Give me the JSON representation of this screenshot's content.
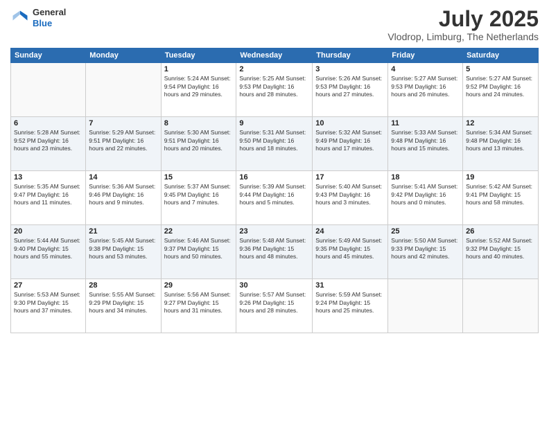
{
  "header": {
    "logo": {
      "line1": "General",
      "line2": "Blue"
    },
    "title": "July 2025",
    "location": "Vlodrop, Limburg, The Netherlands"
  },
  "weekdays": [
    "Sunday",
    "Monday",
    "Tuesday",
    "Wednesday",
    "Thursday",
    "Friday",
    "Saturday"
  ],
  "weeks": [
    [
      {
        "day": "",
        "detail": ""
      },
      {
        "day": "",
        "detail": ""
      },
      {
        "day": "1",
        "detail": "Sunrise: 5:24 AM\nSunset: 9:54 PM\nDaylight: 16 hours\nand 29 minutes."
      },
      {
        "day": "2",
        "detail": "Sunrise: 5:25 AM\nSunset: 9:53 PM\nDaylight: 16 hours\nand 28 minutes."
      },
      {
        "day": "3",
        "detail": "Sunrise: 5:26 AM\nSunset: 9:53 PM\nDaylight: 16 hours\nand 27 minutes."
      },
      {
        "day": "4",
        "detail": "Sunrise: 5:27 AM\nSunset: 9:53 PM\nDaylight: 16 hours\nand 26 minutes."
      },
      {
        "day": "5",
        "detail": "Sunrise: 5:27 AM\nSunset: 9:52 PM\nDaylight: 16 hours\nand 24 minutes."
      }
    ],
    [
      {
        "day": "6",
        "detail": "Sunrise: 5:28 AM\nSunset: 9:52 PM\nDaylight: 16 hours\nand 23 minutes."
      },
      {
        "day": "7",
        "detail": "Sunrise: 5:29 AM\nSunset: 9:51 PM\nDaylight: 16 hours\nand 22 minutes."
      },
      {
        "day": "8",
        "detail": "Sunrise: 5:30 AM\nSunset: 9:51 PM\nDaylight: 16 hours\nand 20 minutes."
      },
      {
        "day": "9",
        "detail": "Sunrise: 5:31 AM\nSunset: 9:50 PM\nDaylight: 16 hours\nand 18 minutes."
      },
      {
        "day": "10",
        "detail": "Sunrise: 5:32 AM\nSunset: 9:49 PM\nDaylight: 16 hours\nand 17 minutes."
      },
      {
        "day": "11",
        "detail": "Sunrise: 5:33 AM\nSunset: 9:48 PM\nDaylight: 16 hours\nand 15 minutes."
      },
      {
        "day": "12",
        "detail": "Sunrise: 5:34 AM\nSunset: 9:48 PM\nDaylight: 16 hours\nand 13 minutes."
      }
    ],
    [
      {
        "day": "13",
        "detail": "Sunrise: 5:35 AM\nSunset: 9:47 PM\nDaylight: 16 hours\nand 11 minutes."
      },
      {
        "day": "14",
        "detail": "Sunrise: 5:36 AM\nSunset: 9:46 PM\nDaylight: 16 hours\nand 9 minutes."
      },
      {
        "day": "15",
        "detail": "Sunrise: 5:37 AM\nSunset: 9:45 PM\nDaylight: 16 hours\nand 7 minutes."
      },
      {
        "day": "16",
        "detail": "Sunrise: 5:39 AM\nSunset: 9:44 PM\nDaylight: 16 hours\nand 5 minutes."
      },
      {
        "day": "17",
        "detail": "Sunrise: 5:40 AM\nSunset: 9:43 PM\nDaylight: 16 hours\nand 3 minutes."
      },
      {
        "day": "18",
        "detail": "Sunrise: 5:41 AM\nSunset: 9:42 PM\nDaylight: 16 hours\nand 0 minutes."
      },
      {
        "day": "19",
        "detail": "Sunrise: 5:42 AM\nSunset: 9:41 PM\nDaylight: 15 hours\nand 58 minutes."
      }
    ],
    [
      {
        "day": "20",
        "detail": "Sunrise: 5:44 AM\nSunset: 9:40 PM\nDaylight: 15 hours\nand 55 minutes."
      },
      {
        "day": "21",
        "detail": "Sunrise: 5:45 AM\nSunset: 9:38 PM\nDaylight: 15 hours\nand 53 minutes."
      },
      {
        "day": "22",
        "detail": "Sunrise: 5:46 AM\nSunset: 9:37 PM\nDaylight: 15 hours\nand 50 minutes."
      },
      {
        "day": "23",
        "detail": "Sunrise: 5:48 AM\nSunset: 9:36 PM\nDaylight: 15 hours\nand 48 minutes."
      },
      {
        "day": "24",
        "detail": "Sunrise: 5:49 AM\nSunset: 9:35 PM\nDaylight: 15 hours\nand 45 minutes."
      },
      {
        "day": "25",
        "detail": "Sunrise: 5:50 AM\nSunset: 9:33 PM\nDaylight: 15 hours\nand 42 minutes."
      },
      {
        "day": "26",
        "detail": "Sunrise: 5:52 AM\nSunset: 9:32 PM\nDaylight: 15 hours\nand 40 minutes."
      }
    ],
    [
      {
        "day": "27",
        "detail": "Sunrise: 5:53 AM\nSunset: 9:30 PM\nDaylight: 15 hours\nand 37 minutes."
      },
      {
        "day": "28",
        "detail": "Sunrise: 5:55 AM\nSunset: 9:29 PM\nDaylight: 15 hours\nand 34 minutes."
      },
      {
        "day": "29",
        "detail": "Sunrise: 5:56 AM\nSunset: 9:27 PM\nDaylight: 15 hours\nand 31 minutes."
      },
      {
        "day": "30",
        "detail": "Sunrise: 5:57 AM\nSunset: 9:26 PM\nDaylight: 15 hours\nand 28 minutes."
      },
      {
        "day": "31",
        "detail": "Sunrise: 5:59 AM\nSunset: 9:24 PM\nDaylight: 15 hours\nand 25 minutes."
      },
      {
        "day": "",
        "detail": ""
      },
      {
        "day": "",
        "detail": ""
      }
    ]
  ]
}
